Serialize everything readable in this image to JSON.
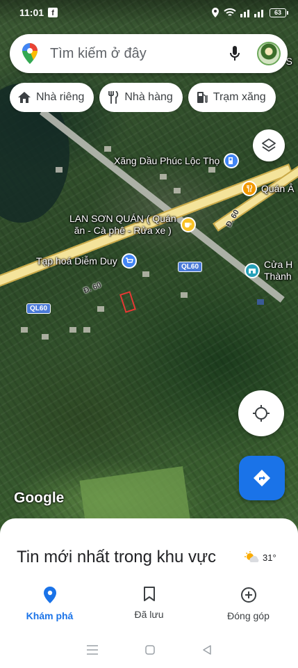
{
  "status_bar": {
    "time": "11:01",
    "facebook_icon": "facebook-icon",
    "battery_level": "63"
  },
  "search": {
    "placeholder": "Tìm kiếm ở đây",
    "mic_icon": "mic-icon"
  },
  "chips": [
    {
      "label": "Nhà riêng",
      "icon": "home-icon"
    },
    {
      "label": "Nhà hàng",
      "icon": "restaurant-icon"
    },
    {
      "label": "Trạm xăng",
      "icon": "gas-station-icon"
    }
  ],
  "map": {
    "pois": [
      {
        "label": "Xăng Dầu Phúc Lộc Thọ"
      },
      {
        "label": "Quán Â"
      },
      {
        "label_line1": "LAN SƠN QUÁN ( Quán",
        "label_line2": "ăn - Cà phê - Rửa xe )"
      },
      {
        "label": "Tạp hoá Diễm Duy"
      },
      {
        "label_line1": "Cửa H",
        "label_line2": "Thành"
      }
    ],
    "road_labels": [
      "Đ. 60",
      "Đ. 60"
    ],
    "route_badges": [
      "QL60",
      "QL60"
    ],
    "edge_text": "à S",
    "attribution": "Google"
  },
  "sheet": {
    "title": "Tin mới nhất trong khu vực",
    "temperature": "31°",
    "weather_icon": "partly-sunny-icon"
  },
  "bottom_nav": [
    {
      "label": "Khám phá",
      "icon": "explore-pin-icon",
      "active": true
    },
    {
      "label": "Đã lưu",
      "icon": "bookmark-icon",
      "active": false
    },
    {
      "label": "Đóng góp",
      "icon": "add-circle-icon",
      "active": false
    }
  ],
  "colors": {
    "accent": "#1a73e8",
    "road": "#f4e39a",
    "route_badge": "#4b7bd8"
  }
}
